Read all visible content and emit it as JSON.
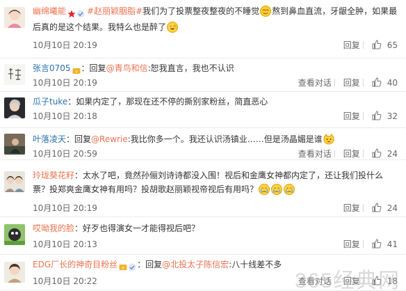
{
  "comments": [
    {
      "user": "幽绵曦能",
      "tag": "#赵丽颖胭脂#",
      "text_parts": [
        "我们为了投票整夜整夜的不睡觉",
        "熬到鼻血直流，牙龈全肿，如果最后真的是这个结果。我特么也是醉了",
        ""
      ],
      "time": "10月10日 20:19",
      "reply_label": "回复",
      "likes": "65"
    },
    {
      "user": "张言0705",
      "reply_prefix": "：回复",
      "mention": "@青鸟和信",
      "text": ":恕我直言，我也不认识",
      "time": "10月10日 20:19",
      "view_label": "查看对话",
      "reply_label": "回复",
      "likes": "40"
    },
    {
      "user": "瓜子tuke",
      "text": "：如果内定了，那现在还不停的撕别家粉丝，简直恶心",
      "time": "10月10日 20:18",
      "reply_label": "回复",
      "likes": "32"
    },
    {
      "user": "叶落凌天",
      "reply_prefix": "：回复",
      "mention": "@Rewrie",
      "text": ":我比你多一个。我还认识汤镇业……但是汤晶媚是谁",
      "time": "10月10日 20:59",
      "view_label": "查看对话",
      "reply_label": "回复",
      "likes": "24"
    },
    {
      "user": "玲珑葵花籽",
      "text": "：太水了吧，竟然孙俪刘诗诗都没入围！视后和金鹰女神都内定了，还让我们投什么票？投郑爽金鹰女神有用吗？投胡歌赵丽颖视帝视后有用吗？",
      "time": "10月10日 20:19",
      "reply_label": "回复",
      "likes": "24"
    },
    {
      "user": "哎呦我的脸",
      "text": "：好歹也得演女一才能得视后吧？",
      "time": "10月10日 20:13",
      "reply_label": "回复",
      "likes": "41"
    },
    {
      "user": "EDG厂长的神奇目粉丝",
      "reply_prefix": "：回复",
      "mention": "@北投太子陈信宏",
      "text": ":八十线差不多",
      "time": "10月10日 20:22",
      "view_label": "查看对话",
      "reply_label": "回复",
      "likes": "18"
    }
  ],
  "watermark": "365经典网",
  "icons": {
    "badge_star": "red-star-icon",
    "badge_vip": "vip-icon",
    "badge_member": "member-icon",
    "emoji_smile": "smile-emoji-icon",
    "emoji_laugh": "laugh-emoji-icon",
    "emoji_cry": "cry-emoji-icon",
    "emoji_cat": "cat-emoji-icon",
    "like": "thumbs-up-icon"
  },
  "colors": {
    "username": "#eb7350",
    "link": "#eb7350",
    "meta": "#666666",
    "divider": "#ececec"
  }
}
